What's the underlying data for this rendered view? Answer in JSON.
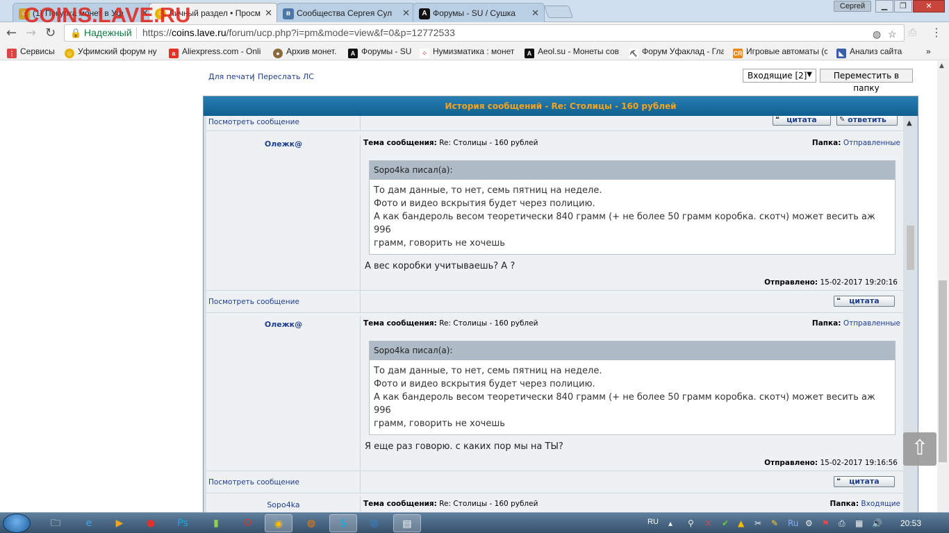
{
  "watermark": "COINS.LAVE.RU",
  "browser": {
    "tabs": [
      {
        "title": "(1) Покупка монет в Уф",
        "icon": "forum-icon"
      },
      {
        "title": "Личный раздел • Просм",
        "icon": "smiley-icon"
      },
      {
        "title": "Сообщества Сергея Сул",
        "icon": "vk-icon"
      },
      {
        "title": "Форумы - SU / Сушка",
        "icon": "su-icon"
      }
    ],
    "user": "Сергей",
    "secure_label": "Надежный",
    "url_scheme": "https://",
    "url_host": "coins.lave.ru",
    "url_path": "/forum/ucp.php?i=pm&mode=view&f=0&p=12772533",
    "bookmarks": [
      {
        "label": "Сервисы",
        "icon": "apps-icon"
      },
      {
        "label": "Уфимский форум ну",
        "icon": "smiley-icon"
      },
      {
        "label": "Aliexpress.com - Onli",
        "icon": "aliexpress-icon"
      },
      {
        "label": "Архив монет.",
        "icon": "coin-icon"
      },
      {
        "label": "Форумы - SU",
        "icon": "su-icon"
      },
      {
        "label": "Нумизматика : монет",
        "icon": "dots-icon"
      },
      {
        "label": "Aeol.su - Монеты сов",
        "icon": "aeol-icon"
      },
      {
        "label": "Форум Уфаклад - Гла",
        "icon": "digger-icon"
      },
      {
        "label": "Игровые автоматы (с",
        "icon": "slot-icon"
      },
      {
        "label": "Анализ сайта",
        "icon": "analysis-icon"
      }
    ],
    "more": "»"
  },
  "controls": {
    "print": "Для печати",
    "separator": "|",
    "forward": "Переслать ЛС",
    "folder_selected": "Входящие [2]",
    "move_button": "Переместить в папку"
  },
  "history": {
    "title": "История сообщений - Re: Столицы - 160 рублей",
    "view_message": "Посмотреть сообщение",
    "quote_btn": "цитата",
    "reply_btn": "ответить",
    "subject_label": "Тема сообщения:",
    "folder_label": "Папка:",
    "sent_label": "Отправлено:",
    "messages": [
      {
        "author": "Олежк@",
        "subject": "Re: Столицы - 160 рублей",
        "folder": "Отправленные",
        "quote_author": "Sopo4ka писал(а):",
        "quote_lines": [
          "То дам данные, то нет, семь пятниц на неделе.",
          "Фото и видео вскрытия будет через полицию.",
          "А как бандероль весом теоретически 840 грамм (+ не более 50 грамм коробка. скотч) может весить аж 996",
          "грамм, говорить не хочешь"
        ],
        "reply": "А вес коробки учитываешь? А ?",
        "sent": "15-02-2017 19:20:16"
      },
      {
        "author": "Олежк@",
        "subject": "Re: Столицы - 160 рублей",
        "folder": "Отправленные",
        "quote_author": "Sopo4ka писал(а):",
        "quote_lines": [
          "То дам данные, то нет, семь пятниц на неделе.",
          "Фото и видео вскрытия будет через полицию.",
          "А как бандероль весом теоретически 840 грамм (+ не более 50 грамм коробка. скотч) может весить аж 996",
          "грамм, говорить не хочешь"
        ],
        "reply": "Я еще раз говорю. с каких пор мы на ТЫ?",
        "sent": "15-02-2017 19:16:56"
      },
      {
        "author": "Sopo4ka",
        "subject": "Re: Столицы - 160 рублей",
        "folder": "Входящие"
      }
    ]
  },
  "taskbar": {
    "lang": "RU",
    "clock": "20:53"
  }
}
